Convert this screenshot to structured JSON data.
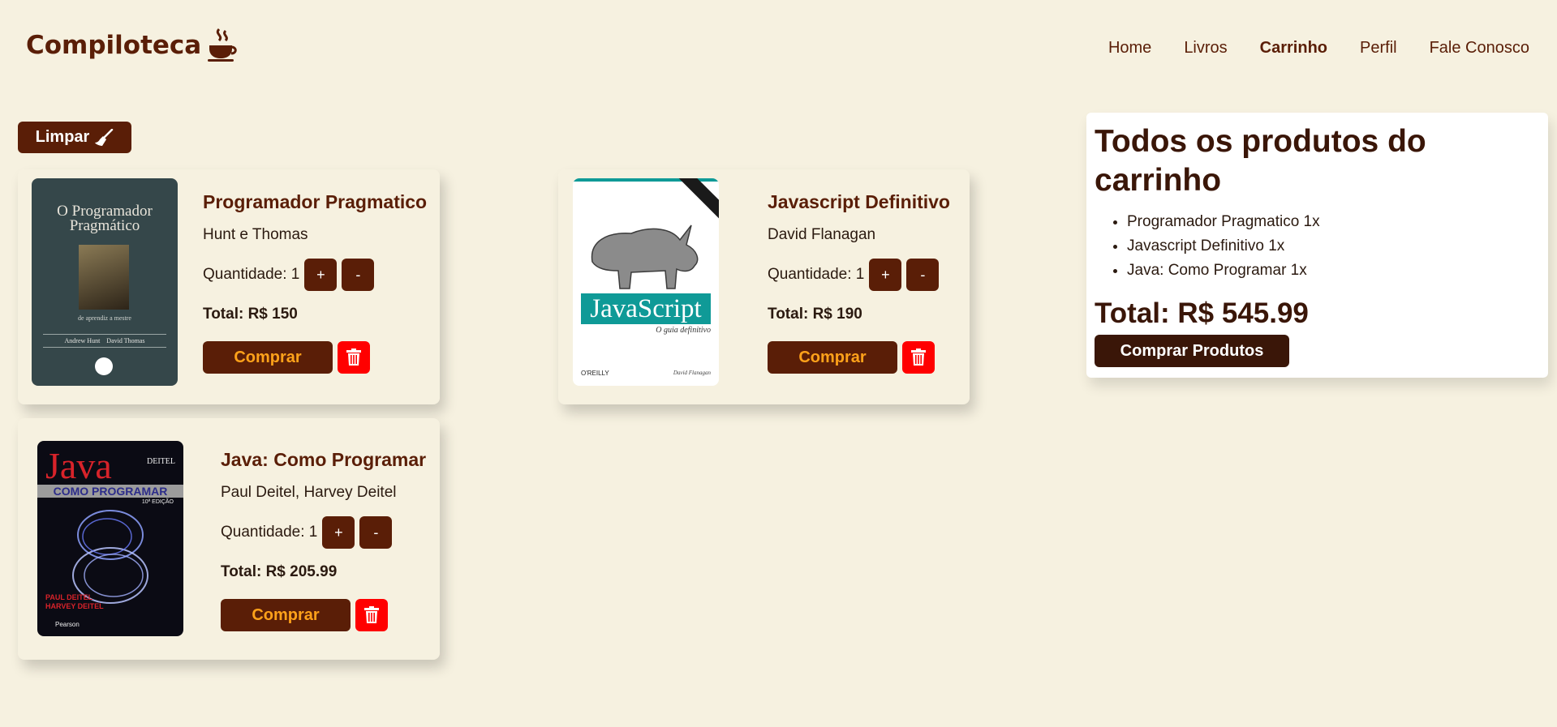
{
  "header": {
    "logo_text": "Compiloteca",
    "nav": [
      {
        "label": "Home"
      },
      {
        "label": "Livros"
      },
      {
        "label": "Carrinho",
        "active": true
      },
      {
        "label": "Perfil"
      },
      {
        "label": "Fale Conosco"
      }
    ]
  },
  "clear_label": "Limpar",
  "cart": {
    "quantity_label": "Quantidade: 1",
    "buy_label": "Comprar",
    "plus_label": "+",
    "minus_label": "-",
    "items": [
      {
        "title": "Programador Pragmatico",
        "author": "Hunt e Thomas",
        "total": "Total: R$ 150",
        "cover": {
          "title": "O Programador Pragmático",
          "subtitle": "de aprendiz a mestre",
          "authors": "Andrew Hunt    David Thomas"
        }
      },
      {
        "title": "Javascript Definitivo",
        "author": "David Flanagan",
        "total": "Total: R$ 190",
        "cover": {
          "title": "JavaScript",
          "subtitle": "O guia definitivo",
          "publisher": "O'REILLY",
          "author": "David Flanagan"
        }
      },
      {
        "title": "Java: Como Programar",
        "author": "Paul Deitel, Harvey Deitel",
        "total": "Total: R$ 205.99",
        "cover": {
          "title": "Java",
          "subtitle": "COMO PROGRAMAR",
          "edition": "10ª EDIÇÃO",
          "brand": "DEITEL",
          "publisher": "Pearson",
          "authors": "PAUL DEITEL HARVEY DEITEL"
        }
      }
    ]
  },
  "summary": {
    "heading": "Todos os produtos do carrinho",
    "items": [
      "Programador Pragmatico 1x",
      "Javascript Definitivo 1x",
      "Java: Como Programar 1x"
    ],
    "total": "Total: R$ 545.99",
    "buy_all_label": "Comprar Produtos"
  },
  "colors": {
    "brand": "#5a1e07",
    "accent": "#ffa21a",
    "delete": "#ff0000",
    "background": "#f6f1e0"
  }
}
